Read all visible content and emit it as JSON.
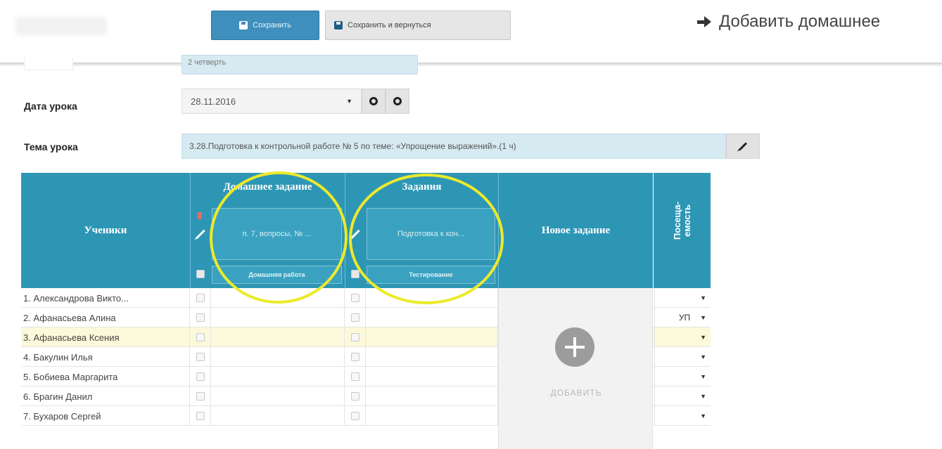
{
  "toolbar": {
    "save_label": "Сохранить",
    "save_return_label": "Сохранить и вернуться",
    "add_homework_label": "Добавить домашнее"
  },
  "form": {
    "quarter_value": "2 четверть",
    "date_label": "Дата урока",
    "date_value": "28.11.2016",
    "topic_label": "Тема урока",
    "topic_value": "3.28.Подготовка к контрольной работе № 5 по теме: «Упрощение выражений».(1 ч)"
  },
  "table": {
    "students_header": "Ученики",
    "homework_header": "Домашнее задание",
    "homework_task": "п. 7, вопросы, № ...",
    "homework_type": "Домашняя работа",
    "tasks_header": "Задания",
    "tasks_task": "Подготовка к кон...",
    "tasks_type": "Тестирование",
    "new_task_header": "Новое задание",
    "attendance_header": "Посеща-\nемость",
    "add_label": "ДОБАВИТЬ",
    "rows": [
      {
        "name": "1. Александрова Викто...",
        "attendance": ""
      },
      {
        "name": "2. Афанасьева Алина",
        "attendance": "УП"
      },
      {
        "name": "3. Афанасьева Ксения",
        "attendance": ""
      },
      {
        "name": "4. Бакулин Илья",
        "attendance": ""
      },
      {
        "name": "5. Бобиева Маргарита",
        "attendance": ""
      },
      {
        "name": "6. Брагин Данил",
        "attendance": ""
      },
      {
        "name": "7. Бухаров Сергей",
        "attendance": ""
      }
    ]
  },
  "colors": {
    "header_bg": "#2e96b5",
    "save_button": "#3f8fbd",
    "highlight_row": "#fcf8da",
    "annotation_circle": "#ecea2a"
  },
  "icons": [
    "save-disk-icon",
    "arrow-right-icon",
    "prev-circle-icon",
    "next-circle-icon",
    "pencil-icon",
    "plus-circle-icon",
    "caret-down-icon"
  ]
}
